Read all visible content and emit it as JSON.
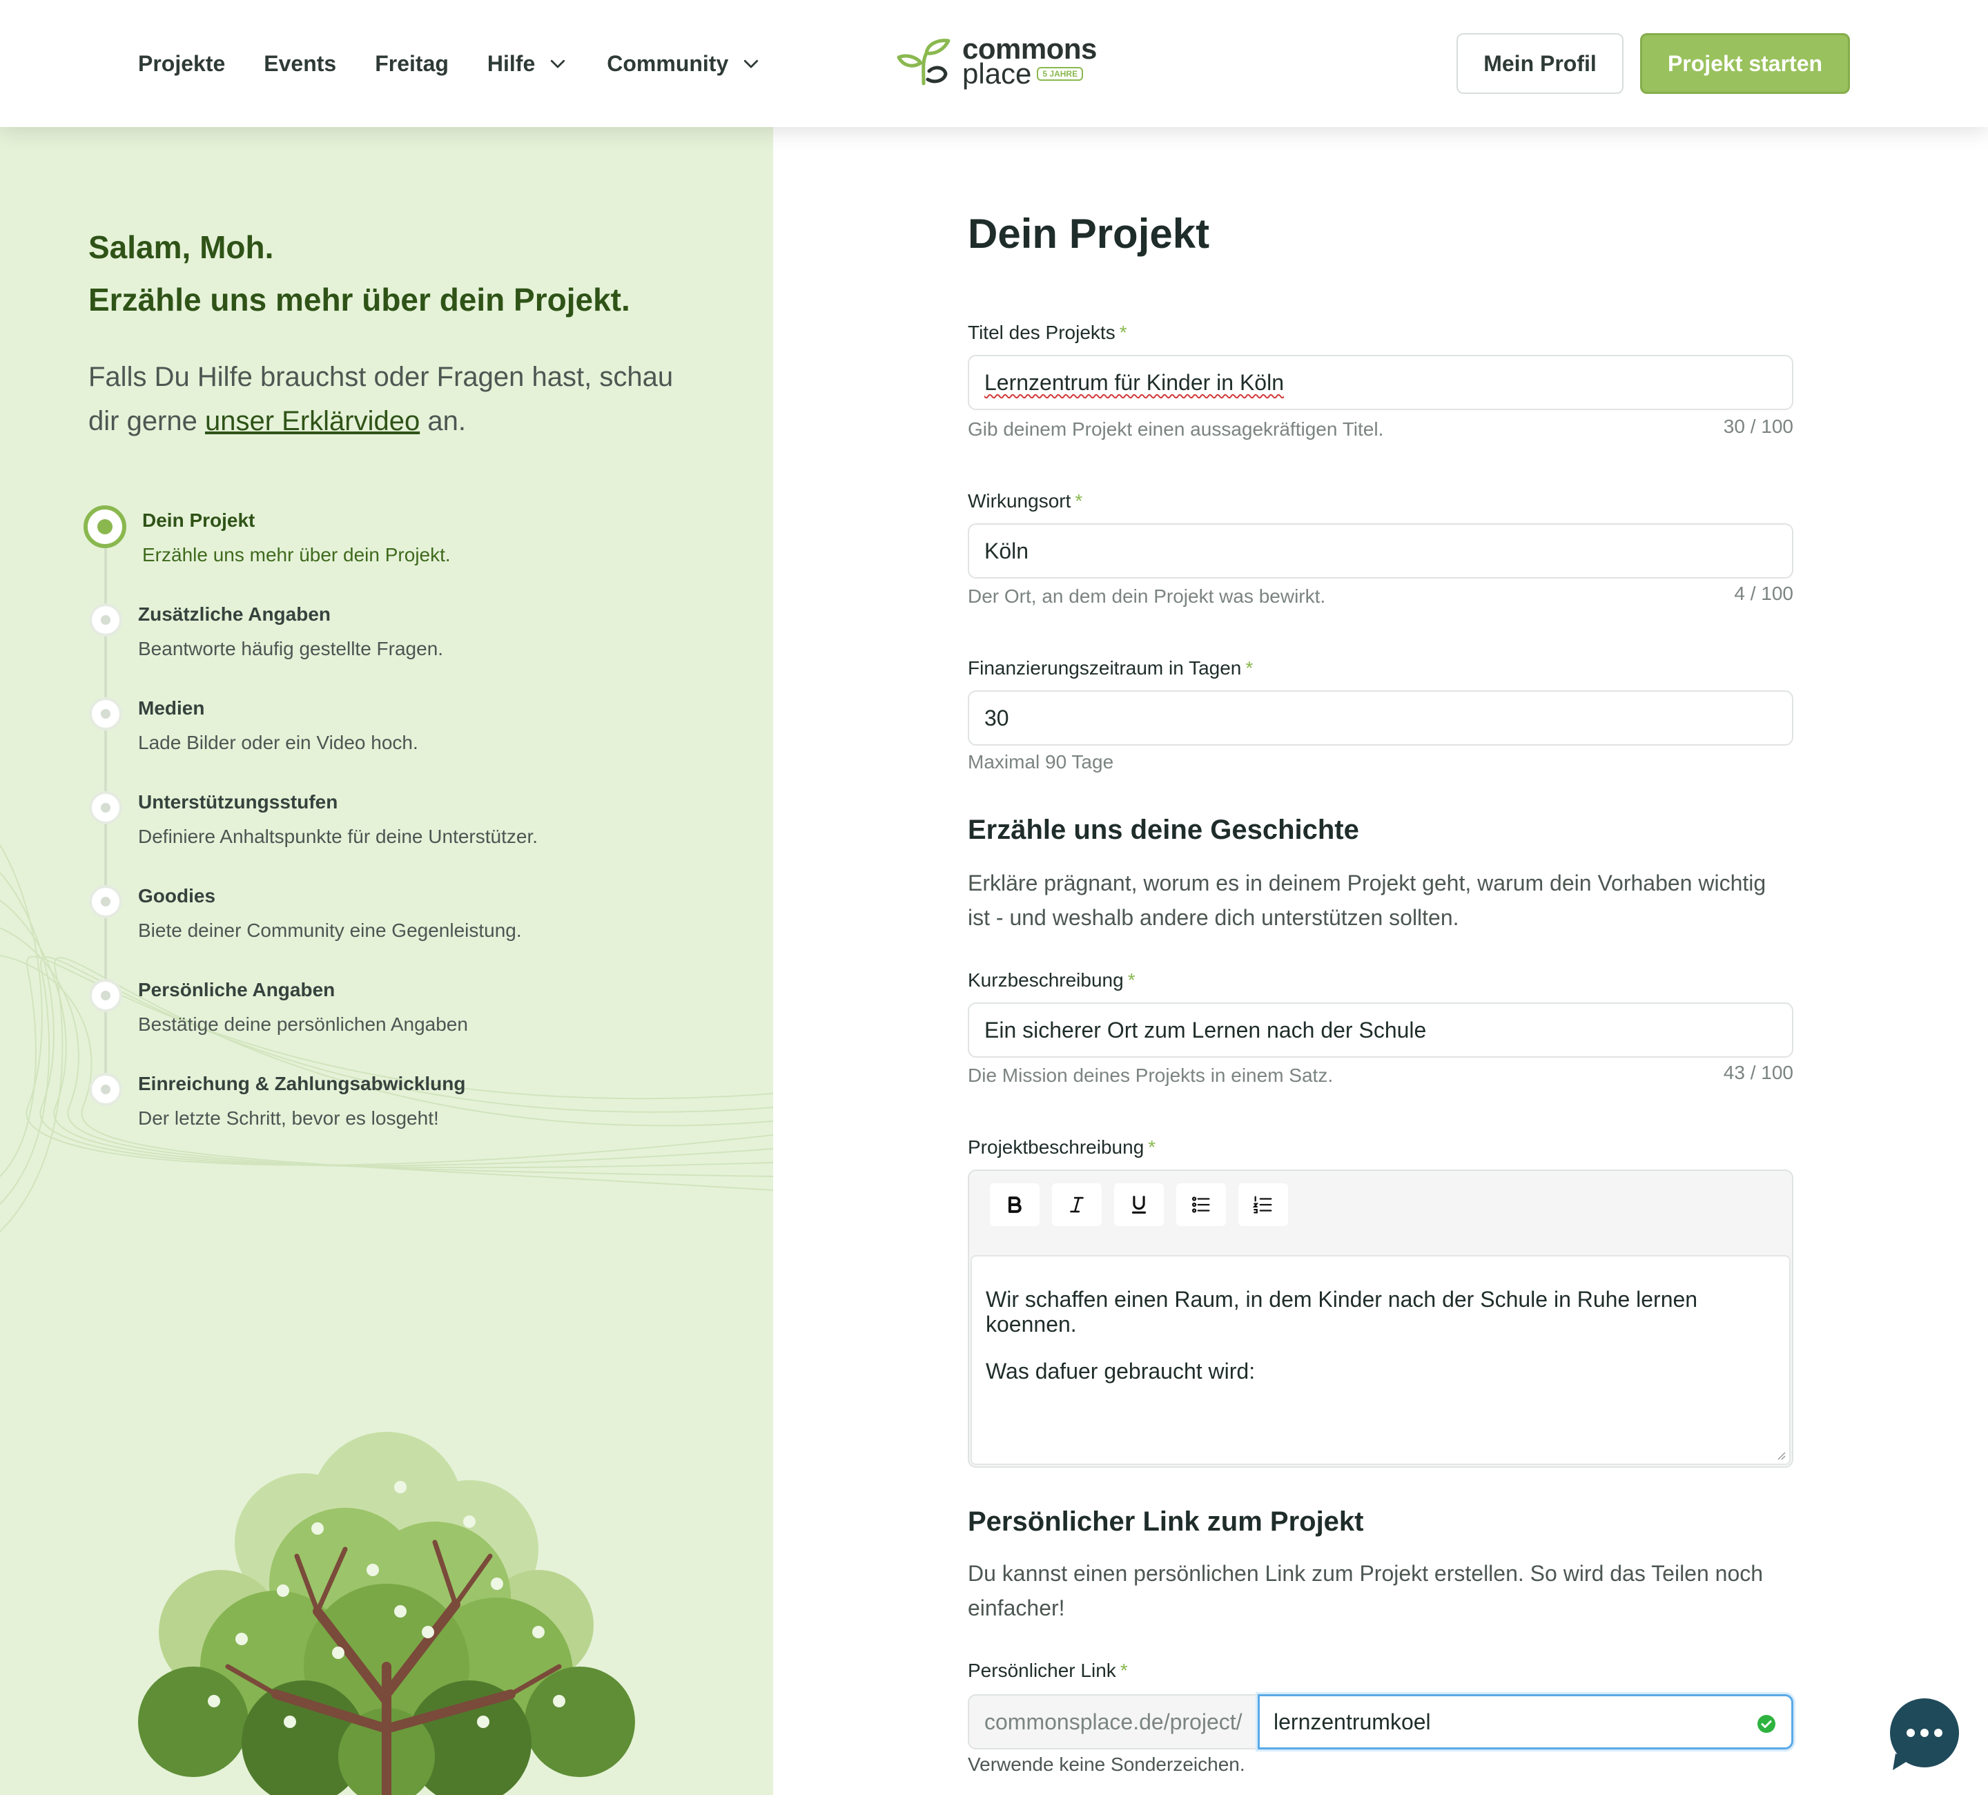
{
  "nav": {
    "items": [
      {
        "label": "Projekte"
      },
      {
        "label": "Events"
      },
      {
        "label": "Freitag"
      },
      {
        "label": "Hilfe",
        "icon": "chevron-down-icon"
      },
      {
        "label": "Community",
        "icon": "chevron-down-icon"
      }
    ],
    "logo": {
      "line1": "commons",
      "line2": "place",
      "badge": "5 JAHRE"
    },
    "profile_button": "Mein Profil",
    "start_button": "Projekt starten"
  },
  "sidebar": {
    "greeting_line1": "Salam, Moh.",
    "greeting_line2": "Erzähle uns mehr über dein Projekt.",
    "help_text_before": "Falls Du Hilfe brauchst oder Fragen hast, schau dir gerne ",
    "help_link": "unser Erklärvideo",
    "help_text_after": " an.",
    "steps": [
      {
        "title": "Dein Projekt",
        "desc": "Erzähle uns mehr über dein Projekt.",
        "active": true
      },
      {
        "title": "Zusätzliche Angaben",
        "desc": "Beantworte häufig gestellte Fragen."
      },
      {
        "title": "Medien",
        "desc": "Lade Bilder oder ein Video hoch."
      },
      {
        "title": "Unterstützungsstufen",
        "desc": "Definiere Anhaltspunkte für deine Unterstützer."
      },
      {
        "title": "Goodies",
        "desc": "Biete deiner Community eine Gegenleistung."
      },
      {
        "title": "Persönliche Angaben",
        "desc": "Bestätige deine persönlichen Angaben"
      },
      {
        "title": "Einreichung & Zahlungsabwicklung",
        "desc": "Der letzte Schritt, bevor es losgeht!"
      }
    ]
  },
  "form": {
    "title": "Dein Projekt",
    "required_mark": "*",
    "project_title": {
      "label": "Titel des Projekts",
      "value": "Lernzentrum für Kinder in Köln",
      "hint": "Gib deinem Projekt einen aussagekräftigen Titel.",
      "count": "30 / 100"
    },
    "location": {
      "label": "Wirkungsort",
      "value": "Köln",
      "hint": "Der Ort, an dem dein Projekt was bewirkt.",
      "count": "4 / 100"
    },
    "duration": {
      "label": "Finanzierungszeitraum in Tagen",
      "value": "30",
      "hint": "Maximal 90 Tage"
    },
    "story": {
      "title": "Erzähle uns deine Geschichte",
      "text": "Erkläre prägnant, worum es in deinem Projekt geht, warum dein Vorhaben wichtig ist - und weshalb andere dich unterstützen sollten."
    },
    "short_desc": {
      "label": "Kurzbeschreibung",
      "value": "Ein sicherer Ort zum Lernen nach der Schule",
      "hint": "Die Mission deines Projekts in einem Satz.",
      "count": "43 / 100"
    },
    "description": {
      "label": "Projektbeschreibung",
      "toolbar": [
        "bold-icon",
        "italic-icon",
        "underline-icon",
        "bullet-list-icon",
        "numbered-list-icon"
      ],
      "paragraph1": "Wir schaffen einen Raum, in dem Kinder nach der Schule in Ruhe lernen koennen.",
      "paragraph2": "Was dafuer gebraucht wird:"
    },
    "personal_link": {
      "title": "Persönlicher Link zum Projekt",
      "text": "Du kannst einen persönlichen Link zum Projekt erstellen. So wird das Teilen noch einfacher!",
      "label": "Persönlicher Link",
      "prefix": "commonsplace.de/project/",
      "value": "lernzentrumkoel",
      "hint": "Verwende keine Sonderzeichen."
    }
  },
  "chat": {
    "icon": "chat-icon"
  },
  "colors": {
    "accent": "#99c15d",
    "dark_green": "#2f5317",
    "panel": "#e5f2d8",
    "chat": "#1f4a5a"
  }
}
